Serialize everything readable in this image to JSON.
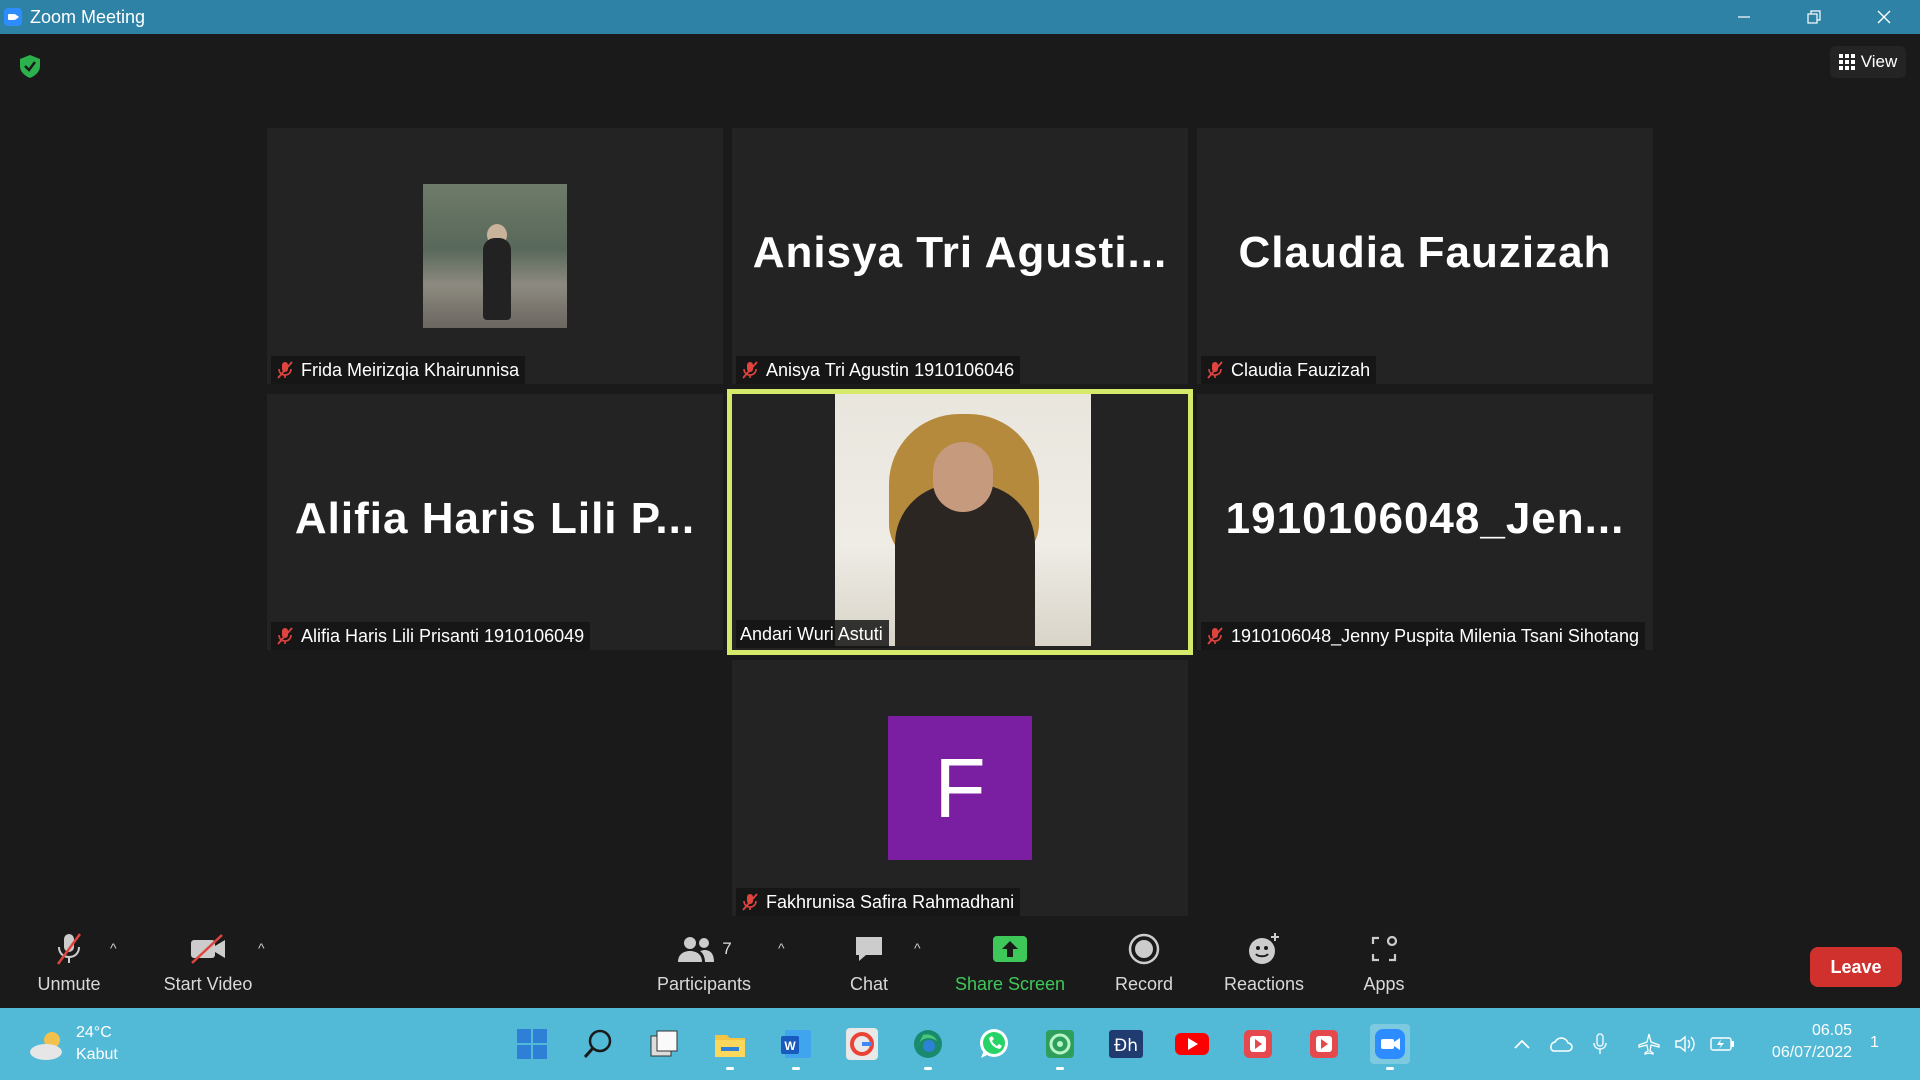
{
  "window": {
    "title": "Zoom Meeting"
  },
  "top_bar": {
    "view_label": "View"
  },
  "tiles": [
    {
      "display_name": "",
      "label": "Frida Meirizqia Khairunnisa",
      "type": "photo"
    },
    {
      "display_name": "Anisya  Tri  Agusti...",
      "label": "Anisya Tri Agustin 1910106046",
      "type": "name"
    },
    {
      "display_name": "Claudia Fauzizah",
      "label": "Claudia Fauzizah",
      "type": "name"
    },
    {
      "display_name": "Alifia  Haris  Lili  P...",
      "label": "Alifia Haris Lili Prisanti 1910106049",
      "type": "name"
    },
    {
      "display_name": "",
      "label": "Andari Wuri Astuti",
      "type": "video",
      "speaking": true
    },
    {
      "display_name": "1910106048_Jen...",
      "label": "1910106048_Jenny Puspita Milenia Tsani Sihotang",
      "type": "name"
    },
    {
      "display_name": "F",
      "label": "Fakhrunisa Safira Rahmadhani",
      "type": "avatar"
    }
  ],
  "toolbar": {
    "unmute_label": "Unmute",
    "start_video_label": "Start Video",
    "participants_label": "Participants",
    "participants_count": "7",
    "chat_label": "Chat",
    "share_screen_label": "Share Screen",
    "record_label": "Record",
    "reactions_label": "Reactions",
    "apps_label": "Apps",
    "leave_label": "Leave"
  },
  "taskbar": {
    "weather_temp": "24°C",
    "weather_condition": "Kabut",
    "time": "06.05",
    "date": "06/07/2022",
    "notification_count": "1"
  },
  "colors": {
    "titlebar": "#2d82a6",
    "active_speaker": "#d7e96a",
    "leave": "#d0312d",
    "share": "#3ec85a",
    "taskbar": "#52b9d6",
    "avatar": "#7b1fa2"
  }
}
